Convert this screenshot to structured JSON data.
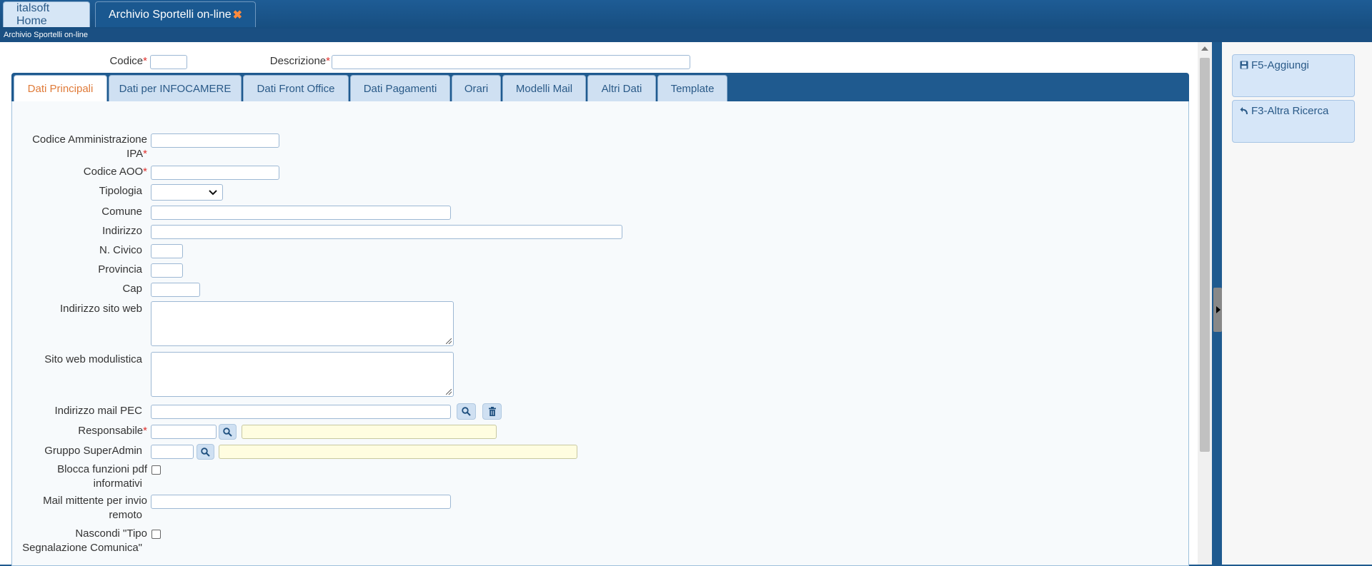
{
  "window": {
    "tabs": [
      {
        "label": "italsoft Home"
      },
      {
        "label": "Archivio Sportelli on-line",
        "close": "✖"
      }
    ],
    "subtitle": "Archivio Sportelli on-line"
  },
  "header": {
    "codice_label": "Codice",
    "codice_value": "",
    "descrizione_label": "Descrizione",
    "descrizione_value": "",
    "required_mark": "*"
  },
  "form_tabs": [
    {
      "label": "Dati Principali"
    },
    {
      "label": "Dati per INFOCAMERE"
    },
    {
      "label": "Dati Front Office"
    },
    {
      "label": "Dati Pagamenti"
    },
    {
      "label": "Orari"
    },
    {
      "label": "Modelli Mail"
    },
    {
      "label": "Altri Dati"
    },
    {
      "label": "Template"
    }
  ],
  "fields": {
    "ipa_line1": "Codice Amministrazione",
    "ipa_line2": "IPA",
    "aoo": "Codice AOO",
    "tipologia": "Tipologia",
    "comune": "Comune",
    "indirizzo": "Indirizzo",
    "civico": "N. Civico",
    "provincia": "Provincia",
    "cap": "Cap",
    "sito_web": "Indirizzo sito web",
    "sito_modulistica": "Sito web modulistica",
    "mail_pec": "Indirizzo mail PEC",
    "responsabile": "Responsabile",
    "gruppo": "Gruppo SuperAdmin",
    "blocca_line1": "Blocca funzioni pdf",
    "blocca_line2": "informativi",
    "mittente_line1": "Mail mittente per invio",
    "mittente_line2": "remoto",
    "nascondi_line1": "Nascondi \"Tipo",
    "nascondi_line2": "Segnalazione Comunica\""
  },
  "side_buttons": [
    {
      "label": "F5-Aggiungi",
      "icon": "save-icon"
    },
    {
      "label": "F3-Altra Ricerca",
      "icon": "undo-icon"
    }
  ],
  "colors": {
    "titlebar": "#1f5a8f",
    "active_tab_text": "#e07b39",
    "required": "#e0302c",
    "lookup_field": "#fffde0"
  }
}
